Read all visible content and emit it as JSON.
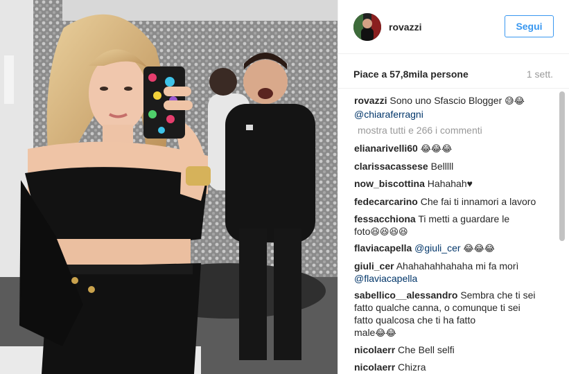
{
  "post": {
    "photo": {
      "description_icon": "photo-image",
      "phone_case_colors": [
        "#1b1b1b",
        "#e63e6d",
        "#3ec3e8",
        "#f2d13a",
        "#9b59d0",
        "#4fcf6a"
      ]
    }
  },
  "header": {
    "username": "rovazzi",
    "follow_label": "Segui",
    "accent": "#3897f0"
  },
  "stats": {
    "likes": "Piace a 57,8mila persone",
    "time": "1 sett."
  },
  "caption": {
    "user": "rovazzi",
    "text": " Sono uno Sfascio Blogger ",
    "emoji": "😅😂",
    "mention": "@chiaraferragni"
  },
  "show_all_comments": "mostra tutti e 266 i commenti",
  "comments": [
    {
      "user": "elianarivelli60",
      "text": "",
      "emoji": "😂😂😂"
    },
    {
      "user": "clarissacassese",
      "text": "Belllll"
    },
    {
      "user": "now_biscottina",
      "text": "Hahahah♥"
    },
    {
      "user": "fedecarcarino",
      "text": "Che fai ti innamori a lavoro"
    },
    {
      "user": "fessacchiona",
      "text": "Ti metti a guardare le",
      "text2": "foto",
      "emoji": "😆😆😆😆"
    },
    {
      "user": "flaviacapella",
      "mention": "@giuli_cer",
      "emoji": "😂😂😂"
    },
    {
      "user": "giuli_cer",
      "text": "Ahahahahhahaha mi fa morì",
      "mention": "@flaviacapella"
    },
    {
      "user": "sabellico__alessandro",
      "text": "Sembra che ti sei",
      "lines": [
        "fatto qualche canna, o comunque ti sei",
        "fatto qualcosa che ti ha fatto",
        "male"
      ],
      "emoji": "😂😂"
    },
    {
      "user": "nicolaerr",
      "text": "Che Bell selfi"
    },
    {
      "user": "nicolaerr",
      "text": "Chizra"
    }
  ]
}
